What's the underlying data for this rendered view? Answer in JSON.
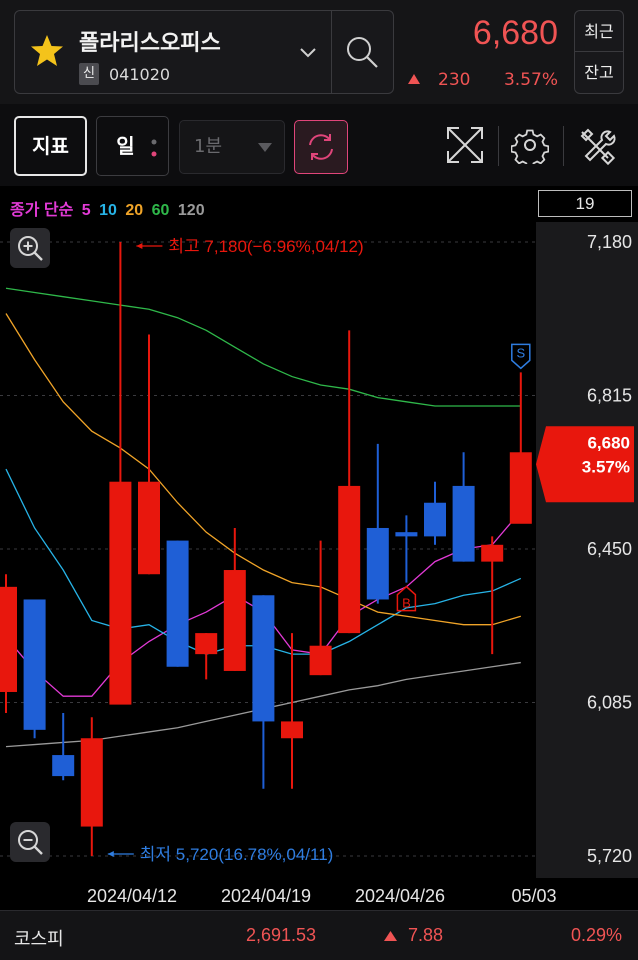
{
  "header": {
    "stock_name": "폴라리스오피스",
    "badge": "신",
    "stock_code": "041020",
    "price": "6,680",
    "change_abs": "230",
    "change_pct": "3.57%",
    "btn_recent": "최근",
    "btn_balance": "잔고"
  },
  "toolbar": {
    "indicator_label": "지표",
    "period_label": "일",
    "interval_label": "1분"
  },
  "legend": {
    "prefix": "종가 단순",
    "ma": [
      {
        "label": "5",
        "color": "#e23ad6"
      },
      {
        "label": "10",
        "color": "#27b3e6"
      },
      {
        "label": "20",
        "color": "#f0a428"
      },
      {
        "label": "60",
        "color": "#2fb84a"
      },
      {
        "label": "120",
        "color": "#9a9a9a"
      }
    ],
    "count": "19"
  },
  "chart_data": {
    "type": "candlestick",
    "ylim": [
      5720,
      7180
    ],
    "y_ticks": [
      "7,180",
      "6,815",
      "6,450",
      "6,085",
      "5,720"
    ],
    "x_tick_labels": [
      "2024/04/12",
      "2024/04/19",
      "2024/04/26",
      "05/03"
    ],
    "current_price_label": "6,680",
    "current_change_label": "3.57%",
    "high_annotation": "최고 7,180(−6.96%,04/12)",
    "low_annotation": "최저 5,720(16.78%,04/11)",
    "up_color": "#e8170d",
    "down_color": "#1f5fd6",
    "candles": [
      {
        "o": 6110,
        "h": 6390,
        "l": 6060,
        "c": 6360
      },
      {
        "o": 6330,
        "h": 6330,
        "l": 6000,
        "c": 6020
      },
      {
        "o": 5960,
        "h": 6060,
        "l": 5900,
        "c": 5910
      },
      {
        "o": 5790,
        "h": 6050,
        "l": 5720,
        "c": 6000
      },
      {
        "o": 6080,
        "h": 7180,
        "l": 6090,
        "c": 6610
      },
      {
        "o": 6390,
        "h": 6960,
        "l": 6390,
        "c": 6610
      },
      {
        "o": 6470,
        "h": 6470,
        "l": 6170,
        "c": 6170
      },
      {
        "o": 6200,
        "h": 6250,
        "l": 6140,
        "c": 6250
      },
      {
        "o": 6160,
        "h": 6500,
        "l": 6160,
        "c": 6400
      },
      {
        "o": 6340,
        "h": 6340,
        "l": 5880,
        "c": 6040
      },
      {
        "o": 6000,
        "h": 6250,
        "l": 5880,
        "c": 6040
      },
      {
        "o": 6150,
        "h": 6470,
        "l": 6150,
        "c": 6220
      },
      {
        "o": 6250,
        "h": 6970,
        "l": 6250,
        "c": 6600
      },
      {
        "o": 6500,
        "h": 6700,
        "l": 6320,
        "c": 6330
      },
      {
        "o": 6490,
        "h": 6530,
        "l": 6370,
        "c": 6480
      },
      {
        "o": 6560,
        "h": 6610,
        "l": 6460,
        "c": 6480
      },
      {
        "o": 6600,
        "h": 6680,
        "l": 6420,
        "c": 6420
      },
      {
        "o": 6420,
        "h": 6480,
        "l": 6200,
        "c": 6460
      },
      {
        "o": 6510,
        "h": 6870,
        "l": 6530,
        "c": 6680
      }
    ],
    "markers": [
      {
        "index": 14,
        "label": "B",
        "color": "#e8170d"
      },
      {
        "index": 18,
        "label": "S",
        "color": "#2f7de0"
      }
    ],
    "series": [
      {
        "name": "5",
        "color": "#e23ad6",
        "values": [
          6240,
          6160,
          6100,
          6100,
          6180,
          6230,
          6270,
          6300,
          6340,
          6300,
          6210,
          6200,
          6290,
          6330,
          6360,
          6420,
          6450,
          6460,
          6540
        ]
      },
      {
        "name": "10",
        "color": "#27b3e6",
        "values": [
          6640,
          6500,
          6400,
          6280,
          6260,
          6270,
          6230,
          6200,
          6220,
          6220,
          6200,
          6200,
          6230,
          6270,
          6310,
          6320,
          6340,
          6350,
          6380
        ]
      },
      {
        "name": "20",
        "color": "#f0a428",
        "values": [
          7010,
          6900,
          6800,
          6730,
          6690,
          6640,
          6560,
          6490,
          6440,
          6400,
          6370,
          6360,
          6330,
          6300,
          6290,
          6280,
          6270,
          6270,
          6290
        ]
      },
      {
        "name": "60",
        "color": "#2fb84a",
        "values": [
          7070,
          7060,
          7050,
          7040,
          7030,
          7020,
          7000,
          6970,
          6930,
          6890,
          6860,
          6840,
          6830,
          6810,
          6800,
          6790,
          6790,
          6790,
          6790
        ]
      },
      {
        "name": "120",
        "color": "#9a9a9a",
        "values": [
          5980,
          5985,
          5990,
          5995,
          6005,
          6015,
          6025,
          6040,
          6055,
          6070,
          6085,
          6100,
          6115,
          6125,
          6140,
          6150,
          6160,
          6170,
          6180
        ]
      }
    ]
  },
  "footer": {
    "index_name": "코스피",
    "index_value": "2,691.53",
    "index_change": "7.88",
    "index_pct": "0.29%"
  }
}
